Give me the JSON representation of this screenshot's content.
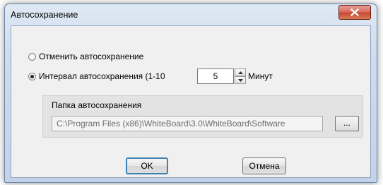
{
  "dialog": {
    "title": "Автосохранение"
  },
  "options": {
    "disable_label": "Отменить автосохранение",
    "disable_checked": false,
    "interval_label": "Интервал автосохранения (1-10",
    "interval_checked": true,
    "interval_value": "5",
    "unit_label": "Минут"
  },
  "folder": {
    "group_title": "Папка автосохранения",
    "path": "C:\\Program Files (x86)\\WhiteBoard\\3.0\\WhiteBoard\\Software",
    "browse_label": "..."
  },
  "buttons": {
    "ok_label": "OK",
    "cancel_label": "Отмена"
  }
}
